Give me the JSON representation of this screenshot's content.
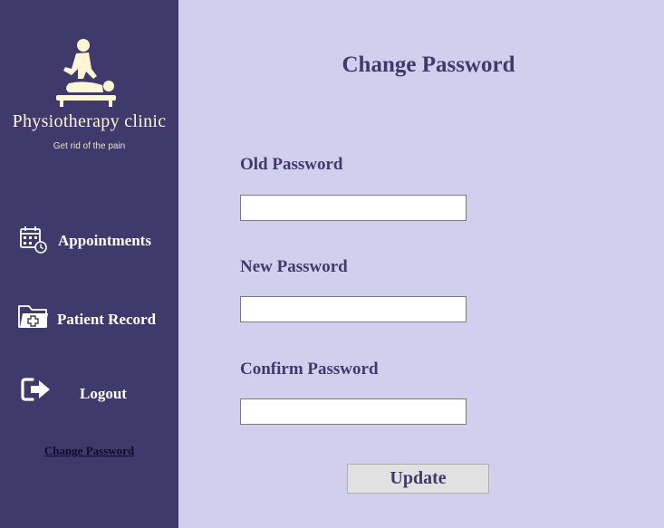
{
  "sidebar": {
    "logo_icon": "physiotherapy-massage-icon",
    "clinic_name": "Physiotherapy clinic",
    "tagline": "Get rid of the pain",
    "nav": {
      "appointments": {
        "label": "Appointments",
        "icon": "calendar-clock-icon"
      },
      "patient_record": {
        "label": "Patient Record",
        "icon": "medical-folder-icon"
      },
      "logout": {
        "label": "Logout",
        "icon": "logout-icon"
      }
    },
    "change_password_link": "Change Password"
  },
  "main": {
    "title": "Change Password",
    "fields": {
      "old_password": {
        "label": "Old Password",
        "value": ""
      },
      "new_password": {
        "label": "New Password",
        "value": ""
      },
      "confirm_password": {
        "label": "Confirm Password",
        "value": ""
      }
    },
    "update_button": "Update"
  },
  "colors": {
    "sidebar_bg": "#3f3a6b",
    "main_bg": "#d2cfee",
    "accent_text": "#3f3a6b",
    "logo_cream": "#fdf6d6",
    "link_text": "#0c0a2e",
    "button_bg": "#e1e1e1"
  }
}
